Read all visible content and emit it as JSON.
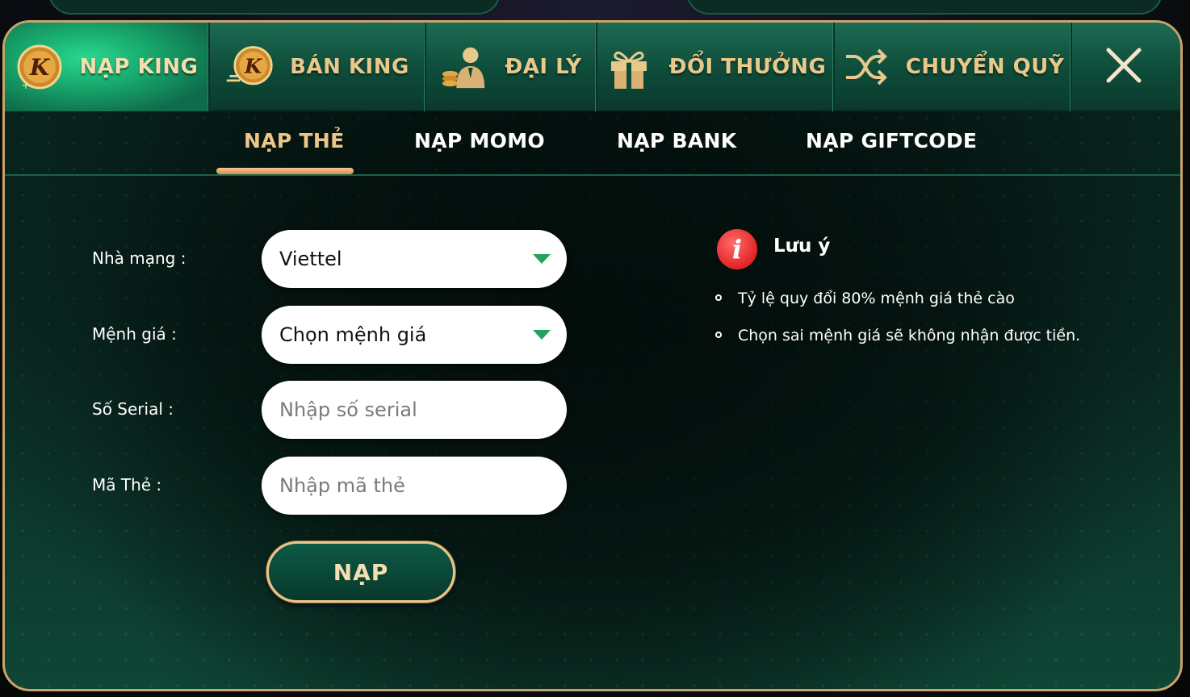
{
  "top_tabs": [
    {
      "label": "NẠP KING",
      "icon": "king-coin-icon",
      "active": true
    },
    {
      "label": "BÁN KING",
      "icon": "king-coin-sell-icon",
      "active": false
    },
    {
      "label": "ĐẠI LÝ",
      "icon": "agent-icon",
      "active": false
    },
    {
      "label": "ĐỔI THƯỞNG",
      "icon": "gift-icon",
      "active": false
    },
    {
      "label": "CHUYỂN QUỸ",
      "icon": "shuffle-icon",
      "active": false
    }
  ],
  "sub_tabs": [
    {
      "label": "NẠP THẺ",
      "active": true
    },
    {
      "label": "NẠP MOMO",
      "active": false
    },
    {
      "label": "NẠP BANK",
      "active": false
    },
    {
      "label": "NẠP GIFTCODE",
      "active": false
    }
  ],
  "form": {
    "network_label": "Nhà mạng :",
    "network_value": "Viettel",
    "denomination_label": "Mệnh giá :",
    "denomination_value": "Chọn mệnh giá",
    "serial_label": "Số Serial :",
    "serial_placeholder": "Nhập số serial",
    "code_label": "Mã Thẻ :",
    "code_placeholder": "Nhập mã thẻ",
    "submit_label": "NẠP"
  },
  "note": {
    "title": "Lưu ý",
    "items": [
      "Tỷ lệ quy đổi 80% mệnh giá thẻ cào",
      "Chọn sai mệnh giá sẽ không nhận được tiền."
    ]
  },
  "colors": {
    "accent_gold": "#e7c98b",
    "active_tab_green": "#17a56b",
    "active_subtab": "#f0c58a",
    "caret_green": "#1fa65a",
    "info_red": "#e32424"
  }
}
